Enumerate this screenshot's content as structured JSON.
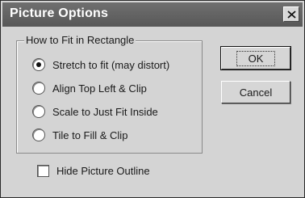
{
  "window": {
    "title": "Picture Options"
  },
  "group": {
    "label": "How to Fit in Rectangle",
    "options": [
      {
        "label": "Stretch to fit (may distort)",
        "selected": true
      },
      {
        "label": "Align Top Left & Clip",
        "selected": false
      },
      {
        "label": "Scale to Just Fit Inside",
        "selected": false
      },
      {
        "label": "Tile to Fill & Clip",
        "selected": false
      }
    ]
  },
  "buttons": {
    "ok": "OK",
    "cancel": "Cancel"
  },
  "checkbox": {
    "label": "Hide Picture Outline",
    "checked": false
  },
  "icons": {
    "close": "close-icon"
  }
}
